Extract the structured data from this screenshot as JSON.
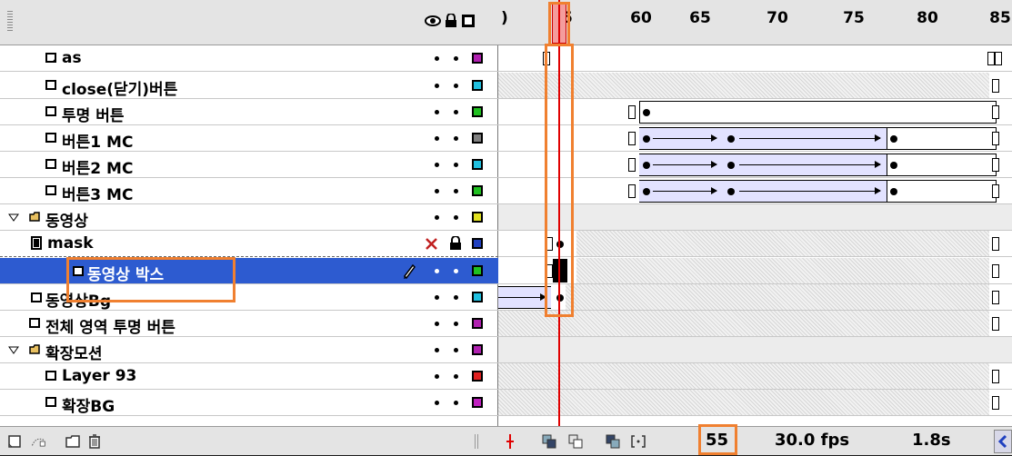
{
  "header": {
    "frame_numbers": [
      "55",
      "60",
      "65",
      "70",
      "75",
      "80",
      "85"
    ],
    "partial_left_number": ")"
  },
  "layers": [
    {
      "name": "as",
      "type": "layer",
      "indent": 1,
      "color": "#b020b0",
      "lock": false,
      "visible_dot": true
    },
    {
      "name": "close(닫기)버튼",
      "type": "layer",
      "indent": 1,
      "color": "#20c0e0"
    },
    {
      "name": "투명 버튼",
      "type": "layer",
      "indent": 1,
      "color": "#20c020"
    },
    {
      "name": "버튼1 MC",
      "type": "layer",
      "indent": 1,
      "color": "#808080"
    },
    {
      "name": "버튼2 MC",
      "type": "layer",
      "indent": 1,
      "color": "#20c0e0"
    },
    {
      "name": "버튼3 MC",
      "type": "layer",
      "indent": 1,
      "color": "#20c020"
    },
    {
      "name": "동영상",
      "type": "folder",
      "indent": 0,
      "color": "#e0e020"
    },
    {
      "name": "mask",
      "type": "mask",
      "indent": 1,
      "color": "#2040c0"
    },
    {
      "name": "동영상 박스",
      "type": "masked",
      "indent": 2,
      "color": "#20c020",
      "selected": true
    },
    {
      "name": "동영상Bg",
      "type": "layer",
      "indent": 1,
      "color": "#20c0e0"
    },
    {
      "name": "전체 영역 투명 버튼",
      "type": "layer",
      "indent": 1,
      "color": "#b020b0"
    },
    {
      "name": "확장모션",
      "type": "folder",
      "indent": 0,
      "color": "#b020b0"
    },
    {
      "name": "Layer 93",
      "type": "layer",
      "indent": 1,
      "color": "#e02020"
    },
    {
      "name": "확장BG",
      "type": "layer",
      "indent": 1,
      "color": "#c020c0"
    }
  ],
  "status": {
    "current_frame": "55",
    "fps": "30.0 fps",
    "time": "1.8s"
  },
  "colors": {
    "selection": "#2d5bd0",
    "playhead": "#e00000",
    "highlight": "#f08030"
  },
  "icons": [
    "eye-icon",
    "lock-icon",
    "outline-icon",
    "pencil-icon",
    "new-layer-icon",
    "add-guide-icon",
    "new-folder-icon",
    "trash-icon",
    "center-frame-icon",
    "onion-skin-icon",
    "onion-outline-icon",
    "edit-multiple-icon",
    "onion-markers-icon"
  ]
}
